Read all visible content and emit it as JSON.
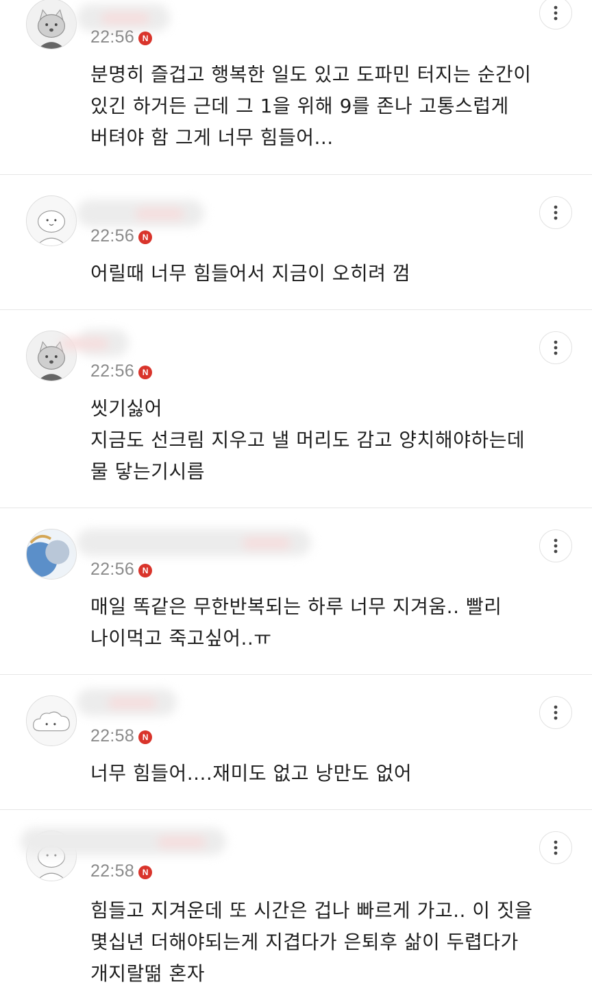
{
  "comments": [
    {
      "time": "22:56",
      "badge": "N",
      "text": "분명히 즐겁고 행복한 일도 있고 도파민 터지는 순간이\n있긴 하거든 근데 그 1을 위해 9를 존나 고통스럽게\n버텨야 함 그게 너무 힘들어...",
      "avatar": "cat-gray-icon"
    },
    {
      "time": "22:56",
      "badge": "N",
      "text": "어릴때 너무 힘들어서 지금이 오히려 껌",
      "avatar": "bunny-white-icon"
    },
    {
      "time": "22:56",
      "badge": "N",
      "text": "씻기싫어\n지금도 선크림 지우고 낼 머리도 감고 양치해야하는데\n물 닿는기시름",
      "avatar": "cat-gray-icon"
    },
    {
      "time": "22:56",
      "badge": "N",
      "text": "매일 똑같은 무한반복되는 하루 너무 지겨움.. 빨리\n나이먹고 죽고싶어..ㅠ",
      "avatar": "photo-blue-icon"
    },
    {
      "time": "22:58",
      "badge": "N",
      "text": "너무 힘들어....재미도 없고 낭만도 없어",
      "avatar": "cloud-white-icon"
    },
    {
      "time": "22:58",
      "badge": "N",
      "text": "힘들고 지겨운데 또 시간은 겁나 빠르게 가고.. 이 짓을\n몇십년 더해야되는게 지겹다가 은퇴후 삶이 두렵다가\n개지랄떪 혼자",
      "avatar": "bunny-white-icon"
    }
  ],
  "colors": {
    "badge": "#d9342b",
    "time": "#8a8a8a",
    "divider": "#e6e6e6"
  }
}
